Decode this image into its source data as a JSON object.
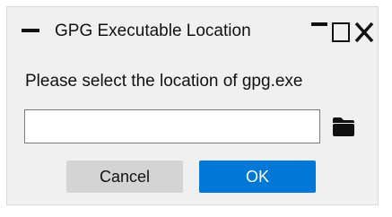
{
  "window": {
    "title": "GPG Executable Location"
  },
  "dialog": {
    "prompt": "Please select the location of gpg.exe",
    "path_value": "",
    "path_placeholder": ""
  },
  "buttons": {
    "cancel_label": "Cancel",
    "ok_label": "OK"
  },
  "icons": {
    "system_menu": "system-menu-icon",
    "minimize": "minimize-icon",
    "maximize": "maximize-icon",
    "close": "close-icon",
    "browse": "folder-icon"
  },
  "colors": {
    "ok_button": "#0078d7",
    "cancel_button": "#d4d4d4",
    "window_background": "#f0f0f0"
  }
}
